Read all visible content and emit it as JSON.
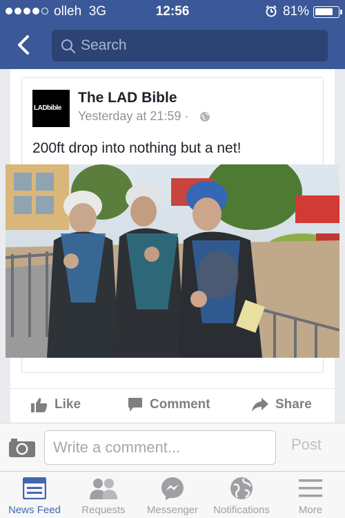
{
  "status_bar": {
    "carrier": "olleh",
    "network": "3G",
    "time": "12:56",
    "battery_text": "81%",
    "battery_level": 0.81,
    "signal_bars": 4
  },
  "nav": {
    "search_placeholder": "Search"
  },
  "post": {
    "page_name": "The LAD Bible",
    "logo_text": "LADbible",
    "timestamp": "Yesterday at 21:59 ·",
    "text": "200ft drop into nothing but a net!"
  },
  "actions": {
    "like": "Like",
    "comment": "Comment",
    "share": "Share"
  },
  "composer": {
    "placeholder": "Write a comment...",
    "post_label": "Post"
  },
  "tabs": [
    {
      "label": "News Feed",
      "icon": "news-feed-icon",
      "active": true
    },
    {
      "label": "Requests",
      "icon": "friends-icon",
      "active": false
    },
    {
      "label": "Messenger",
      "icon": "messenger-icon",
      "active": false
    },
    {
      "label": "Notifications",
      "icon": "globe-icon",
      "active": false
    },
    {
      "label": "More",
      "icon": "menu-icon",
      "active": false
    }
  ],
  "colors": {
    "brand": "#3b5998",
    "active_tab": "#4267b2",
    "inactive_tab": "#9ea0a3"
  }
}
